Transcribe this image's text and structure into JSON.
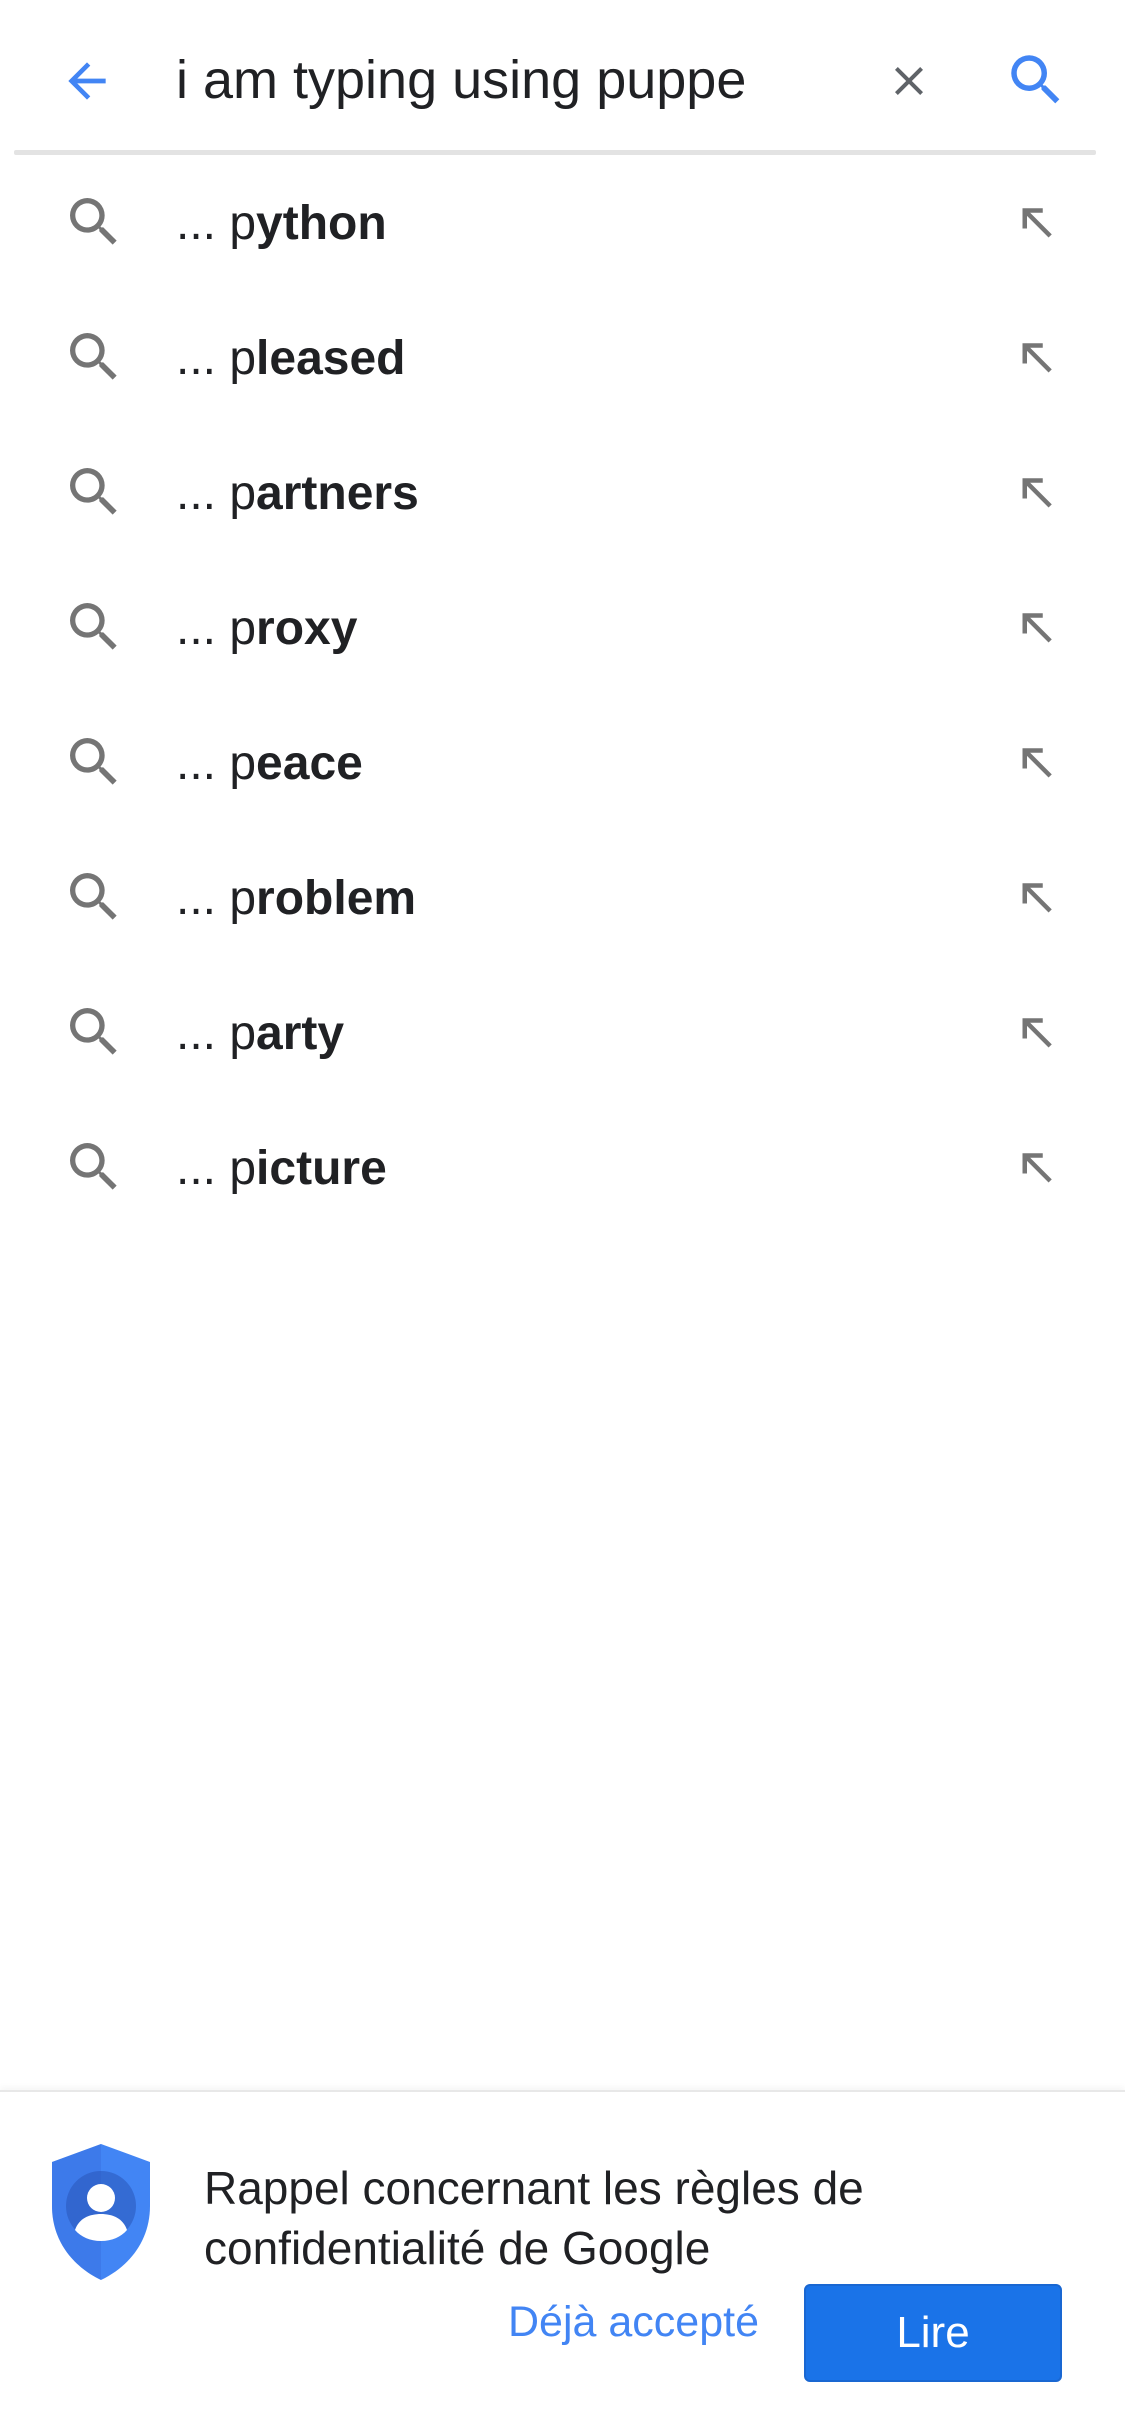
{
  "search": {
    "query": "i am typing using puppe",
    "colors": {
      "accent": "#4285f4",
      "clear_icon": "#757575",
      "text": "#202124"
    },
    "icons": {
      "back": "arrow-left-icon",
      "clear": "close-icon",
      "submit": "search-icon"
    }
  },
  "suggestions": [
    {
      "prefix": "... p",
      "completion": "ython"
    },
    {
      "prefix": "... p",
      "completion": "leased"
    },
    {
      "prefix": "... p",
      "completion": "artners"
    },
    {
      "prefix": "... p",
      "completion": "roxy"
    },
    {
      "prefix": "... p",
      "completion": "eace"
    },
    {
      "prefix": "... p",
      "completion": "roblem"
    },
    {
      "prefix": "... p",
      "completion": "arty"
    },
    {
      "prefix": "... p",
      "completion": "icture"
    }
  ],
  "suggestion_icons": {
    "leading": "search-icon",
    "trailing": "arrow-up-left-icon",
    "color": "#757575"
  },
  "privacy_banner": {
    "message": "Rappel concernant les règles de confidentialité de Google",
    "already_accepted_label": "Déjà accepté",
    "read_label": "Lire",
    "icon": "shield-person-icon",
    "colors": {
      "shield": "#4285f4",
      "button": "#1a73e8",
      "link": "#4285f4"
    }
  }
}
